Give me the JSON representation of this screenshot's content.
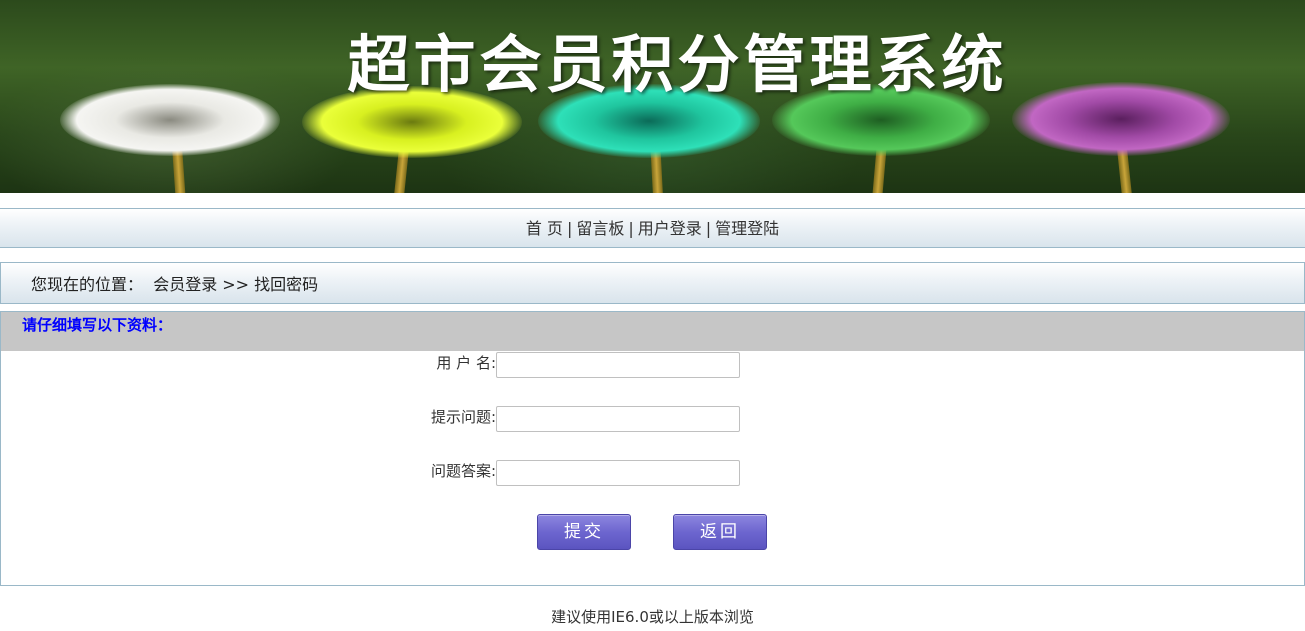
{
  "banner": {
    "title": "超市会员积分管理系统"
  },
  "nav": {
    "items": [
      {
        "label": "首 页"
      },
      {
        "label": "留言板"
      },
      {
        "label": "用户登录"
      },
      {
        "label": "管理登陆"
      }
    ],
    "separator": "|"
  },
  "location": {
    "prefix": "您现在的位置：",
    "path": "会员登录 >> 找回密码"
  },
  "form": {
    "heading": "请仔细填写以下资料：",
    "fields": [
      {
        "label": "用 户 名:",
        "value": ""
      },
      {
        "label": "提示问题:",
        "value": ""
      },
      {
        "label": "问题答案:",
        "value": ""
      }
    ],
    "submit_label": "提交",
    "back_label": "返回"
  },
  "footer": {
    "text": "建议使用IE6.0或以上版本浏览"
  },
  "colors": {
    "heading_text": "#0000ff",
    "button": "#6d66cf",
    "panel_head_bg": "#c6c6c6"
  }
}
